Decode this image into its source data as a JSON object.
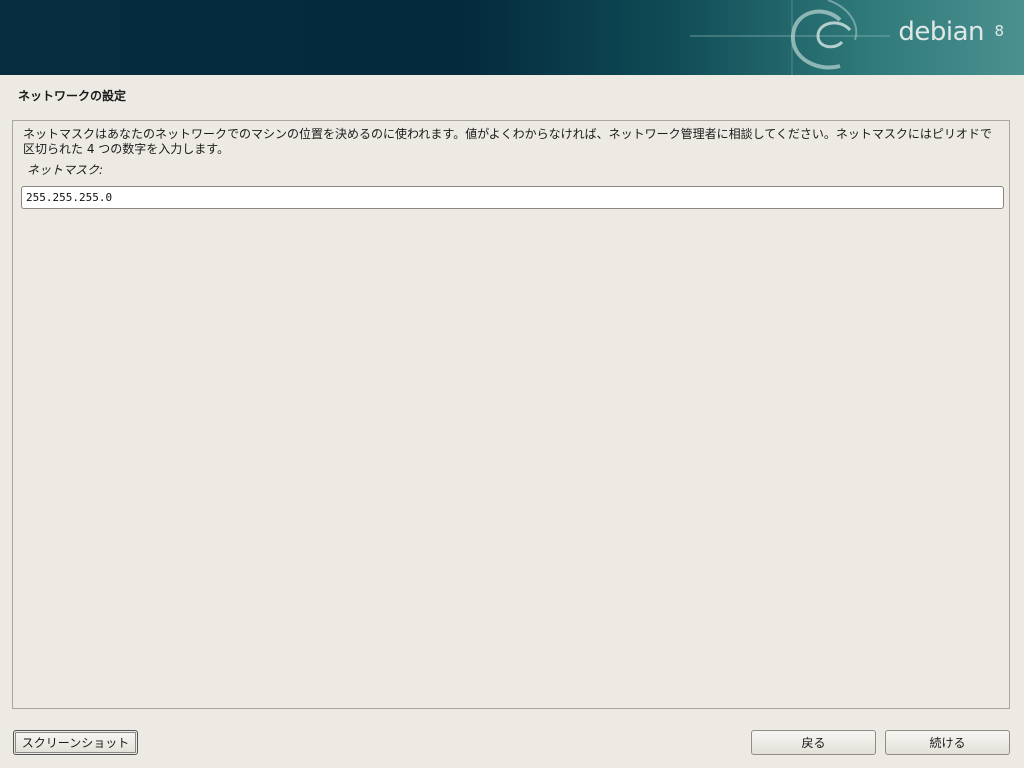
{
  "banner": {
    "brand": "debian",
    "version": "8"
  },
  "page": {
    "title": "ネットワークの設定",
    "description": "ネットマスクはあなたのネットワークでのマシンの位置を決めるのに使われます。値がよくわからなければ、ネットワーク管理者に相談してください。ネットマスクにはピリオドで\n区切られた 4 つの数字を入力します。",
    "field_label": "ネットマスク:",
    "netmask_value": "255.255.255.0"
  },
  "buttons": {
    "screenshot": "スクリーンショット",
    "back": "戻る",
    "continue": "続ける"
  }
}
